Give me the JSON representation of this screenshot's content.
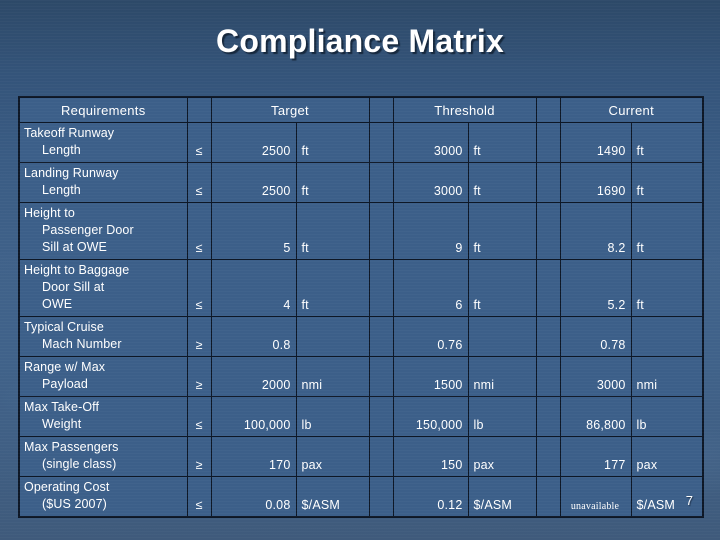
{
  "slide": {
    "title": "Compliance Matrix",
    "page_number": "7",
    "accent_color": "#3c5f89",
    "border_color": "#0d1726",
    "text_color": "#ffffff"
  },
  "table": {
    "headers": {
      "requirements": "Requirements",
      "target": "Target",
      "threshold": "Threshold",
      "current": "Current"
    },
    "rows": [
      {
        "requirement_lines": [
          "Takeoff Runway",
          "Length",
          ""
        ],
        "operator": "≤",
        "target_value": "2500",
        "target_unit": "ft",
        "threshold_value": "3000",
        "threshold_unit": "ft",
        "current_value": "1490",
        "current_unit": "ft"
      },
      {
        "requirement_lines": [
          "Landing Runway",
          "Length",
          ""
        ],
        "operator": "≤",
        "target_value": "2500",
        "target_unit": "ft",
        "threshold_value": "3000",
        "threshold_unit": "ft",
        "current_value": "1690",
        "current_unit": "ft"
      },
      {
        "requirement_lines": [
          "Height to",
          "Passenger Door",
          "Sill at OWE"
        ],
        "operator": "≤",
        "target_value": "5",
        "target_unit": "ft",
        "threshold_value": "9",
        "threshold_unit": "ft",
        "current_value": "8.2",
        "current_unit": "ft"
      },
      {
        "requirement_lines": [
          "Height to Baggage",
          "Door Sill at",
          "OWE"
        ],
        "operator": "≤",
        "target_value": "4",
        "target_unit": "ft",
        "threshold_value": "6",
        "threshold_unit": "ft",
        "current_value": "5.2",
        "current_unit": "ft"
      },
      {
        "requirement_lines": [
          "Typical Cruise",
          "Mach Number",
          ""
        ],
        "operator": "≥",
        "target_value": "0.8",
        "target_unit": "",
        "threshold_value": "0.76",
        "threshold_unit": "",
        "current_value": "0.78",
        "current_unit": ""
      },
      {
        "requirement_lines": [
          "Range w/ Max",
          "Payload",
          ""
        ],
        "operator": "≥",
        "target_value": "2000",
        "target_unit": "nmi",
        "threshold_value": "1500",
        "threshold_unit": "nmi",
        "current_value": "3000",
        "current_unit": "nmi"
      },
      {
        "requirement_lines": [
          "Max Take-Off",
          "Weight",
          ""
        ],
        "operator": "≤",
        "target_value": "100,000",
        "target_unit": "lb",
        "threshold_value": "150,000",
        "threshold_unit": "lb",
        "current_value": "86,800",
        "current_unit": "lb"
      },
      {
        "requirement_lines": [
          "Max Passengers",
          "(single class)",
          ""
        ],
        "operator": "≥",
        "target_value": "170",
        "target_unit": "pax",
        "threshold_value": "150",
        "threshold_unit": "pax",
        "current_value": "177",
        "current_unit": "pax"
      },
      {
        "requirement_lines": [
          "Operating Cost",
          "($US 2007)",
          ""
        ],
        "operator": "≤",
        "target_value": "0.08",
        "target_unit": "$/ASM",
        "threshold_value": "0.12",
        "threshold_unit": "$/ASM",
        "current_value": "unavailable",
        "current_unit": "$/ASM",
        "current_is_text": true
      }
    ]
  }
}
